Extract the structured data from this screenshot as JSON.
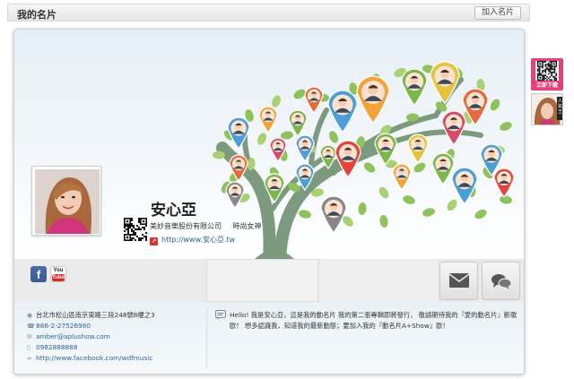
{
  "header": {
    "title": "我的名片",
    "add_button": "加入名片"
  },
  "card": {
    "name": "安心亞",
    "company": "美妙音樂股份有限公司",
    "job_title": "時尚女神",
    "url": "http://www.安心亞.tw"
  },
  "social": {
    "facebook_icon": "facebook-icon",
    "youtube_icon": "youtube-icon",
    "youtube_you": "You",
    "youtube_tube": "Tube"
  },
  "actions": {
    "mail_icon": "envelope-icon",
    "chat_icon": "chat-bubbles-icon"
  },
  "contact": {
    "address": "台北市松山區南京東路三段248號8樓之3",
    "phone": "886-2-27526980",
    "email": "amber@aplushow.com",
    "mobile": "0982888888",
    "facebook": "http://www.facebook.com/wdfmusic"
  },
  "bio": "Hello! 我是安心亞，這是我的動名片 我的第二張專輯即將發行， 敬請期待我的『愛的動名片』新歌歐！ 想多認識我，知道我的最新動態；要加入我的『動名片A+Show』歐！",
  "side": {
    "download_label": "立即下載",
    "aplus_label": "人氣王"
  },
  "colors": {
    "link": "#2b62a6",
    "download_badge": "#e8407a",
    "tree_leaf": "#8fc35a",
    "tree_trunk": "#7c9a7e"
  }
}
